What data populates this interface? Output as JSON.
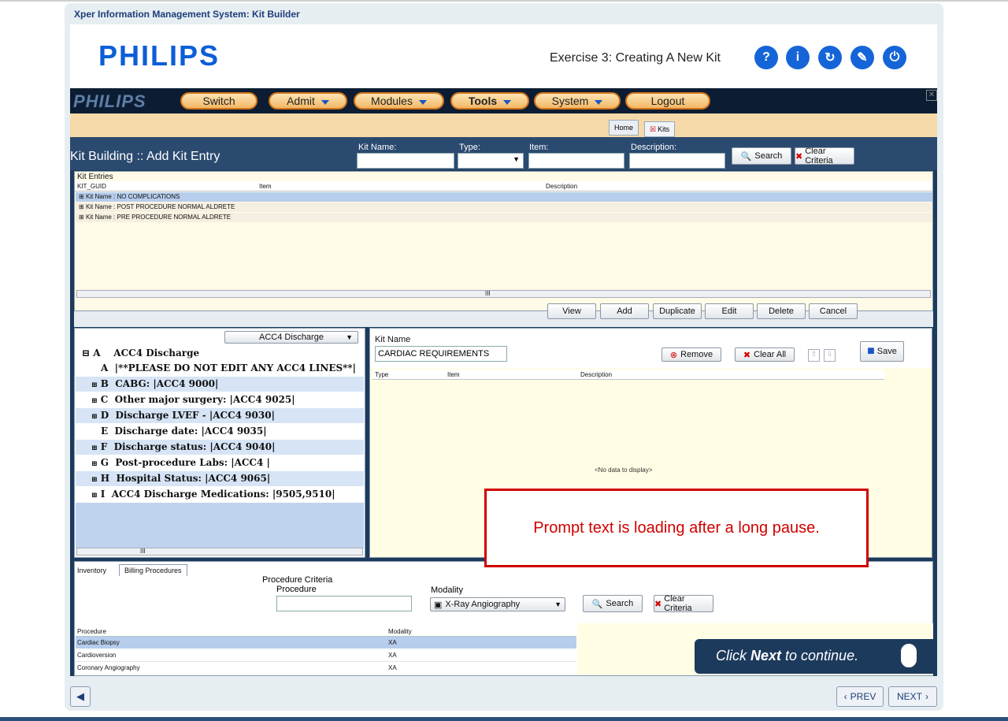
{
  "frame": {
    "title": "Xper Information Management System: Kit Builder",
    "logo": "PHILIPS",
    "exercise_title": "Exercise 3: Creating A New Kit",
    "round_buttons": [
      "?",
      "i",
      "↻",
      "✎",
      "⏻"
    ]
  },
  "app": {
    "logo": "PHILIPS",
    "menu": [
      {
        "label": "Switch",
        "dropdown": false
      },
      {
        "label": "Admit",
        "dropdown": true
      },
      {
        "label": "Modules",
        "dropdown": true
      },
      {
        "label": "Tools",
        "dropdown": true
      },
      {
        "label": "System",
        "dropdown": true
      },
      {
        "label": "Logout",
        "dropdown": false
      }
    ],
    "tabs": {
      "home": "Home",
      "kits": "Kits"
    },
    "page_title": "Kit Building :: Add Kit Entry",
    "criteria": {
      "kit_name_label": "Kit Name:",
      "type_label": "Type:",
      "item_label": "Item:",
      "description_label": "Description:",
      "search_label": "Search",
      "clear_label": "Clear Criteria"
    },
    "kit_entries": {
      "title": "Kit Entries",
      "columns": [
        "KIT_GUID",
        "Item",
        "Description"
      ],
      "rows": [
        "Kit Name : NO COMPLICATIONS",
        "Kit Name : POST PROCEDURE NORMAL ALDRETE",
        "Kit Name : PRE PROCEDURE NORMAL ALDRETE"
      ],
      "scroll_mark": "III",
      "buttons": [
        "View",
        "Add",
        "Duplicate",
        "Edit",
        "Delete",
        "Cancel"
      ]
    },
    "tree": {
      "dropdown_value": "ACC4 Discharge",
      "rows": [
        {
          "key": "A",
          "text": "ACC4 Discharge",
          "indent": 0,
          "expand": "⊟"
        },
        {
          "key": "A",
          "text": "|**PLEASE DO NOT EDIT ANY ACC4 LINES**|",
          "indent": 1,
          "expand": ""
        },
        {
          "key": "B",
          "text": "CABG: |ACC4 9000|",
          "indent": 1,
          "expand": "⊞"
        },
        {
          "key": "C",
          "text": "Other major surgery: |ACC4 9025|",
          "indent": 1,
          "expand": "⊞"
        },
        {
          "key": "D",
          "text": "Discharge LVEF - |ACC4 9030|",
          "indent": 1,
          "expand": "⊞"
        },
        {
          "key": "E",
          "text": "Discharge date: |ACC4 9035|",
          "indent": 1,
          "expand": ""
        },
        {
          "key": "F",
          "text": "Discharge status: |ACC4 9040|",
          "indent": 1,
          "expand": "⊞"
        },
        {
          "key": "G",
          "text": "Post-procedure Labs: |ACC4 |",
          "indent": 1,
          "expand": "⊞"
        },
        {
          "key": "H",
          "text": "Hospital Status: |ACC4 9065|",
          "indent": 1,
          "expand": "⊞"
        },
        {
          "key": "I",
          "text": "ACC4 Discharge Medications: |9505,9510|",
          "indent": 1,
          "expand": "⊞"
        }
      ],
      "scroll_mark": "III"
    },
    "kit_editor": {
      "kit_name_label": "Kit Name",
      "kit_name_value": "CARDIAC REQUIREMENTS",
      "remove_label": "Remove",
      "clear_all_label": "Clear All",
      "save_label": "Save",
      "columns": [
        "Type",
        "Item",
        "Description"
      ],
      "empty_text": "<No data to display>"
    },
    "bottom": {
      "tabs": [
        "Inventory",
        "Billing Procedures"
      ],
      "criteria_title": "Procedure Criteria",
      "procedure_label": "Procedure",
      "modality_label": "Modality",
      "modality_value": "X-Ray Angiography",
      "search_label": "Search",
      "clear_label": "Clear Criteria",
      "columns": [
        "Procedure",
        "Modality"
      ],
      "rows": [
        {
          "procedure": "Cardiac Biopsy",
          "modality": "XA"
        },
        {
          "procedure": "Cardioversion",
          "modality": "XA"
        },
        {
          "procedure": "Coronary Angiography",
          "modality": "XA"
        }
      ]
    }
  },
  "overlay": {
    "prompt": "Prompt text is loading after a long pause.",
    "next_hint_prefix": "Click ",
    "next_hint_bold": "Next",
    "next_hint_suffix": " to continue."
  },
  "nav": {
    "prev": "PREV",
    "next": "NEXT"
  },
  "colors": {
    "accent": "#1565d8",
    "menu_orange": "#f3b866",
    "prompt_red": "#d10000",
    "navy": "#1c3a5c"
  }
}
